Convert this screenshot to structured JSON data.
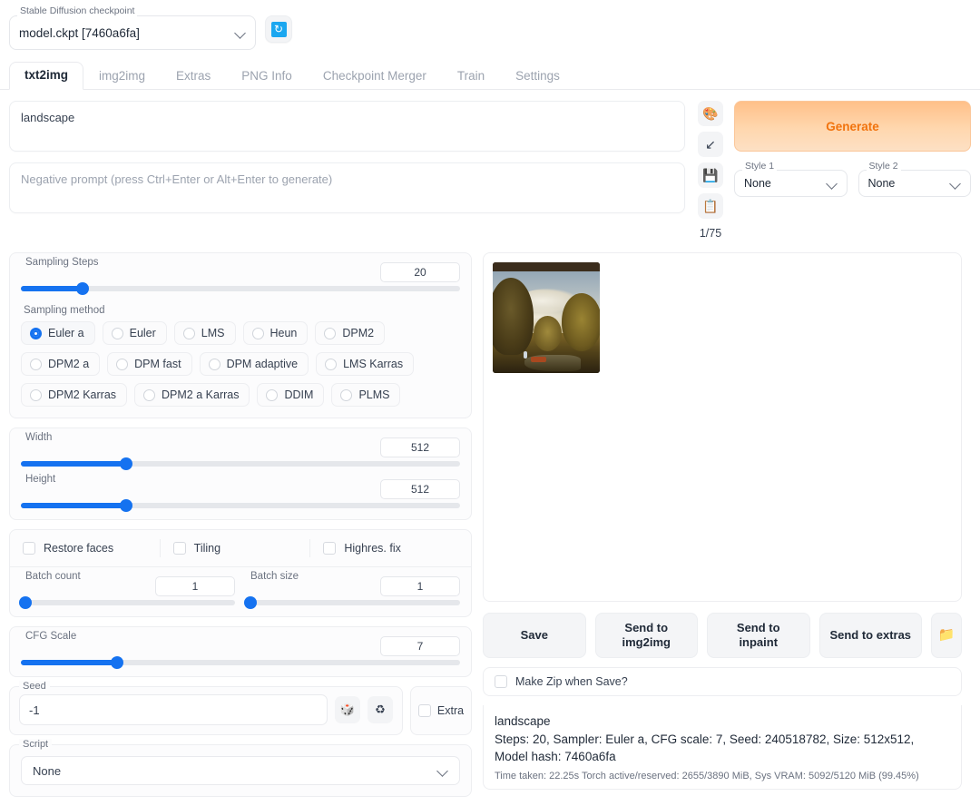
{
  "checkpoint": {
    "label": "Stable Diffusion checkpoint",
    "value": "model.ckpt [7460a6fa]",
    "refresh_icon": "refresh-icon",
    "refresh_glyph": "↻"
  },
  "tabs": [
    {
      "label": "txt2img",
      "active": true
    },
    {
      "label": "img2img",
      "active": false
    },
    {
      "label": "Extras",
      "active": false
    },
    {
      "label": "PNG Info",
      "active": false
    },
    {
      "label": "Checkpoint Merger",
      "active": false
    },
    {
      "label": "Train",
      "active": false
    },
    {
      "label": "Settings",
      "active": false
    }
  ],
  "prompt": {
    "value": "landscape",
    "negative_placeholder": "Negative prompt (press Ctrl+Enter or Alt+Enter to generate)"
  },
  "toolbar": {
    "icons": [
      {
        "name": "palette-icon",
        "glyph": "🎨"
      },
      {
        "name": "arrow-pen-icon",
        "glyph": "↙"
      },
      {
        "name": "floppy-save-icon",
        "glyph": "💾"
      },
      {
        "name": "clipboard-icon",
        "glyph": "📋"
      }
    ],
    "token_count": "1/75",
    "generate_label": "Generate",
    "generate_color": "#f1730d"
  },
  "styles": [
    {
      "label": "Style 1",
      "value": "None"
    },
    {
      "label": "Style 2",
      "value": "None"
    }
  ],
  "sampling": {
    "steps_label": "Sampling Steps",
    "steps_value": "20",
    "steps_percent": 14,
    "method_label": "Sampling method",
    "methods": [
      {
        "label": "Euler a",
        "selected": true
      },
      {
        "label": "Euler",
        "selected": false
      },
      {
        "label": "LMS",
        "selected": false
      },
      {
        "label": "Heun",
        "selected": false
      },
      {
        "label": "DPM2",
        "selected": false
      },
      {
        "label": "DPM2 a",
        "selected": false
      },
      {
        "label": "DPM fast",
        "selected": false
      },
      {
        "label": "DPM adaptive",
        "selected": false
      },
      {
        "label": "LMS Karras",
        "selected": false
      },
      {
        "label": "DPM2 Karras",
        "selected": false
      },
      {
        "label": "DPM2 a Karras",
        "selected": false
      },
      {
        "label": "DDIM",
        "selected": false
      },
      {
        "label": "PLMS",
        "selected": false
      }
    ]
  },
  "dimensions": {
    "width_label": "Width",
    "width_value": "512",
    "width_percent": 24,
    "height_label": "Height",
    "height_value": "512",
    "height_percent": 24
  },
  "options": {
    "restore_faces": "Restore faces",
    "tiling": "Tiling",
    "highres_fix": "Highres. fix"
  },
  "batch": {
    "count_label": "Batch count",
    "count_value": "1",
    "count_percent": 1,
    "size_label": "Batch size",
    "size_value": "1",
    "size_percent": 1
  },
  "cfg": {
    "label": "CFG Scale",
    "value": "7",
    "percent": 22
  },
  "seed": {
    "label": "Seed",
    "value": "-1",
    "dice_glyph": "🎲",
    "recycle_glyph": "♻",
    "extra_label": "Extra"
  },
  "script": {
    "label": "Script",
    "value": "None"
  },
  "result": {
    "image_alt": "generated-landscape-painting",
    "buttons": [
      {
        "name": "save-button",
        "label": "Save"
      },
      {
        "name": "send-to-img2img-button",
        "label": "Send to\nimg2img"
      },
      {
        "name": "send-to-inpaint-button",
        "label": "Send to\ninpaint"
      },
      {
        "name": "send-to-extras-button",
        "label": "Send to extras"
      }
    ],
    "folder_glyph": "📁",
    "make_zip_label": "Make Zip when Save?",
    "info_prompt": "landscape",
    "info_params": "Steps: 20, Sampler: Euler a, CFG scale: 7, Seed: 240518782, Size: 512x512, Model hash: 7460a6fa",
    "info_stats": "Time taken: 22.25s  Torch active/reserved: 2655/3890 MiB, Sys VRAM: 5092/5120 MiB (99.45%)"
  }
}
